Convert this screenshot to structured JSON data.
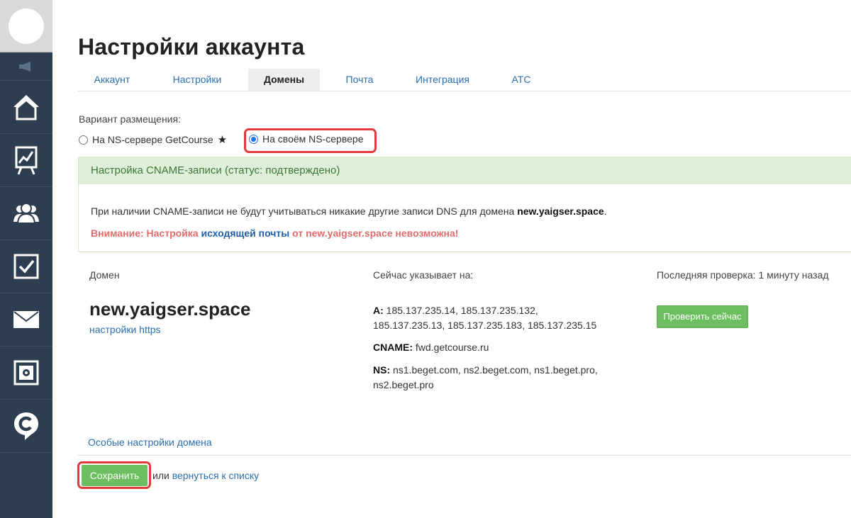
{
  "page": {
    "title": "Настройки аккаунта"
  },
  "tabs": [
    {
      "label": "Аккаунт"
    },
    {
      "label": "Настройки"
    },
    {
      "label": "Домены"
    },
    {
      "label": "Почта"
    },
    {
      "label": "Интеграция"
    },
    {
      "label": "АТС"
    }
  ],
  "placement": {
    "label": "Вариант размещения:",
    "options": [
      {
        "label": "На NS-сервере GetCourse",
        "selected": false,
        "badge": "★"
      },
      {
        "label": "На своём NS-сервере",
        "selected": true
      }
    ]
  },
  "cname": {
    "header": "Настройка CNAME-записи (статус: подтверждено)",
    "text_prefix": "При наличии CNAME-записи не будут учитываться никакие другие записи DNS для домена ",
    "text_domain": "new.yaigser.space",
    "text_suffix": ".",
    "warning_part1": "Внимание: Настройка ",
    "warning_link": "исходящей почты",
    "warning_part2": " от new.yaigser.space невозможна!"
  },
  "domain": {
    "col_domain": "Домен",
    "col_points": "Сейчас указывает на:",
    "col_check": "Последняя проверка: 1 минуту назад",
    "name": "new.yaigser.space",
    "https_link": "настройки https",
    "a_label": "A:",
    "a_value": "185.137.235.14, 185.137.235.132, 185.137.235.13, 185.137.235.183, 185.137.235.15",
    "cname_label": "CNAME:",
    "cname_value": "fwd.getcourse.ru",
    "ns_label": "NS:",
    "ns_value": "ns1.beget.com, ns2.beget.com, ns1.beget.pro, ns2.beget.pro",
    "check_button": "Проверить сейчас"
  },
  "footer": {
    "special_link": "Особые настройки домена",
    "save_button": "Сохранить",
    "or_text": "или ",
    "back_link": "вернуться к списку"
  },
  "colors": {
    "sidebar": "#2d3e50",
    "accent_green": "#6cbf5e",
    "highlight_red": "#e03a3a",
    "link_blue": "#2a6fb0"
  }
}
